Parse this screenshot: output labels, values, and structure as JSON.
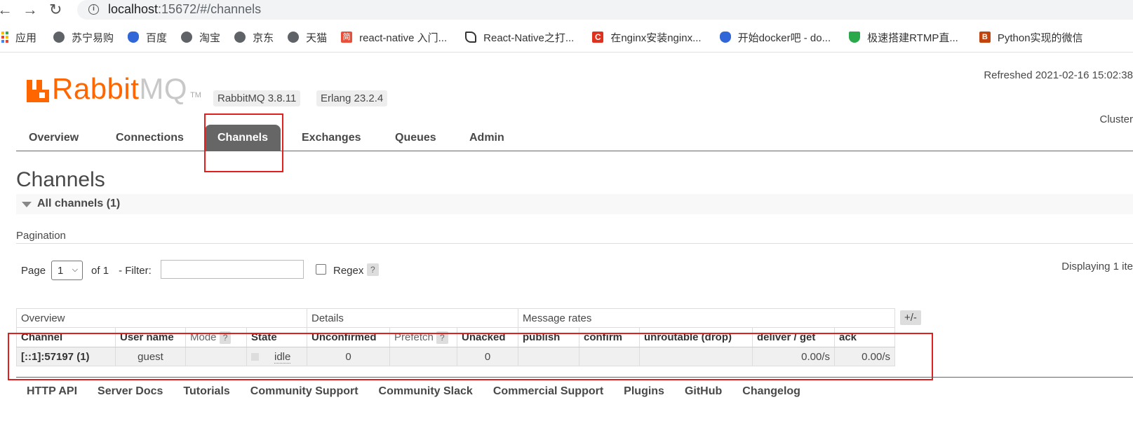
{
  "browser": {
    "url_host": "localhost",
    "url_rest": ":15672/#/channels",
    "bookmarks": [
      {
        "label": "应用",
        "icon": "apps-grid-icon"
      },
      {
        "label": "苏宁易购",
        "icon": "globe-icon"
      },
      {
        "label": "百度",
        "icon": "baidu-paw-icon"
      },
      {
        "label": "淘宝",
        "icon": "globe-icon"
      },
      {
        "label": "京东",
        "icon": "globe-icon"
      },
      {
        "label": "天猫",
        "icon": "globe-icon"
      },
      {
        "label": "react-native 入门...",
        "icon": "jianshu-icon"
      },
      {
        "label": "React-Native之打...",
        "icon": "site-icon"
      },
      {
        "label": "在nginx安装nginx...",
        "icon": "csdn-icon"
      },
      {
        "label": "开始docker吧 - do...",
        "icon": "baidu-paw-icon"
      },
      {
        "label": "极速搭建RTMP直...",
        "icon": "shield-icon"
      },
      {
        "label": "Python实现的微信",
        "icon": "bilibili-icon"
      }
    ]
  },
  "header": {
    "logo_rabbit": "Rabbit",
    "logo_mq": "MQ",
    "logo_tm": "TM",
    "version_rabbit": "RabbitMQ 3.8.11",
    "version_erlang": "Erlang 23.2.4",
    "refreshed": "Refreshed 2021-02-16 15:02:38",
    "cluster": "Cluster"
  },
  "tabs": [
    "Overview",
    "Connections",
    "Channels",
    "Exchanges",
    "Queues",
    "Admin"
  ],
  "active_tab": "Channels",
  "page": {
    "title": "Channels",
    "section": "All channels (1)",
    "pagination_label": "Pagination",
    "page_label": "Page",
    "page_value": "1",
    "of_label": "of 1",
    "filter_label": "- Filter:",
    "filter_value": "",
    "regex_label": "Regex",
    "help": "?",
    "displaying": "Displaying 1 ite"
  },
  "table": {
    "groups": [
      "Overview",
      "Details",
      "Message rates"
    ],
    "plus_minus": "+/-",
    "columns": [
      "Channel",
      "User name",
      "Mode",
      "State",
      "Unconfirmed",
      "Prefetch",
      "Unacked",
      "publish",
      "confirm",
      "unroutable (drop)",
      "deliver / get",
      "ack"
    ],
    "rows": [
      {
        "channel": "[::1]:57197 (1)",
        "user": "guest",
        "mode": "",
        "state": "idle",
        "unconfirmed": "0",
        "prefetch": "",
        "unacked": "0",
        "publish": "",
        "confirm": "",
        "unroutable": "",
        "deliver_get": "0.00/s",
        "ack": "0.00/s"
      }
    ]
  },
  "footer": [
    "HTTP API",
    "Server Docs",
    "Tutorials",
    "Community Support",
    "Community Slack",
    "Commercial Support",
    "Plugins",
    "GitHub",
    "Changelog"
  ],
  "colors": {
    "brand": "#ff6600",
    "annotation": "#e02020",
    "tab_active_bg": "#666666"
  }
}
